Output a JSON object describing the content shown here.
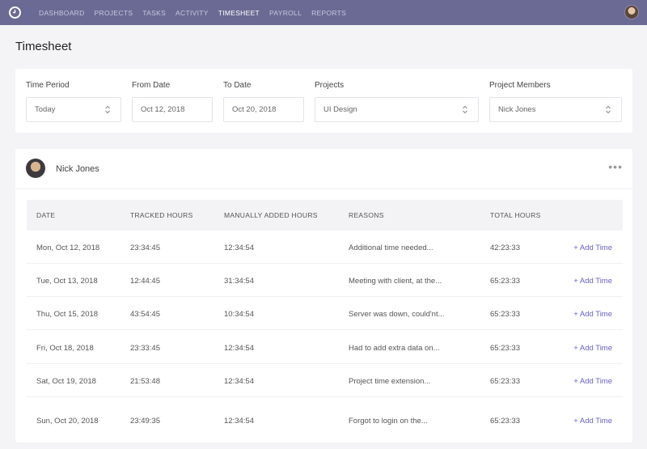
{
  "nav": {
    "items": [
      {
        "label": "DASHBOARD",
        "active": false
      },
      {
        "label": "PROJECTS",
        "active": false
      },
      {
        "label": "TASKS",
        "active": false
      },
      {
        "label": "ACTIVITY",
        "active": false
      },
      {
        "label": "TIMESHEET",
        "active": true
      },
      {
        "label": "PAYROLL",
        "active": false
      },
      {
        "label": "REPORTS",
        "active": false
      }
    ]
  },
  "page": {
    "title": "Timesheet"
  },
  "filters": {
    "time_period": {
      "label": "Time Period",
      "value": "Today"
    },
    "from_date": {
      "label": "From Date",
      "value": "Oct 12, 2018"
    },
    "to_date": {
      "label": "To Date",
      "value": "Oct 20, 2018"
    },
    "projects": {
      "label": "Projects",
      "value": "UI Design"
    },
    "members": {
      "label": "Project Members",
      "value": "Nick Jones"
    }
  },
  "member": {
    "name": "Nick Jones"
  },
  "table": {
    "headers": [
      "DATE",
      "TRACKED HOURS",
      "MANUALLY ADDED HOURS",
      "REASONS",
      "TOTAL HOURS"
    ],
    "action_label": "+ Add Time",
    "rows": [
      [
        "Mon, Oct 12, 2018",
        "23:34:45",
        "12:34:54",
        "Additional time needed...",
        "42:23:33"
      ],
      [
        "Tue, Oct 13, 2018",
        "12:44:45",
        "31:34:54",
        "Meeting with client, at the...",
        "65:23:33"
      ],
      [
        "Thu, Oct 15, 2018",
        "43:54:45",
        "10:34:54",
        "Server was down, could'nt...",
        "65:23:33"
      ],
      [
        "Fri, Oct 18, 2018",
        "23:33:45",
        "12:34:54",
        "Had to add extra data on...",
        "65:23:33"
      ],
      [
        "Sat, Oct 19, 2018",
        "21:53:48",
        "12:34:54",
        "Project time extension...",
        "65:23:33"
      ],
      [
        "Sun, Oct 20, 2018",
        "23:49:35",
        "12:34:54",
        "Forgot to login on the...",
        "65:23:33"
      ]
    ]
  },
  "colors": {
    "topbar": "#6b6a94",
    "accent": "#6a5fc7"
  }
}
